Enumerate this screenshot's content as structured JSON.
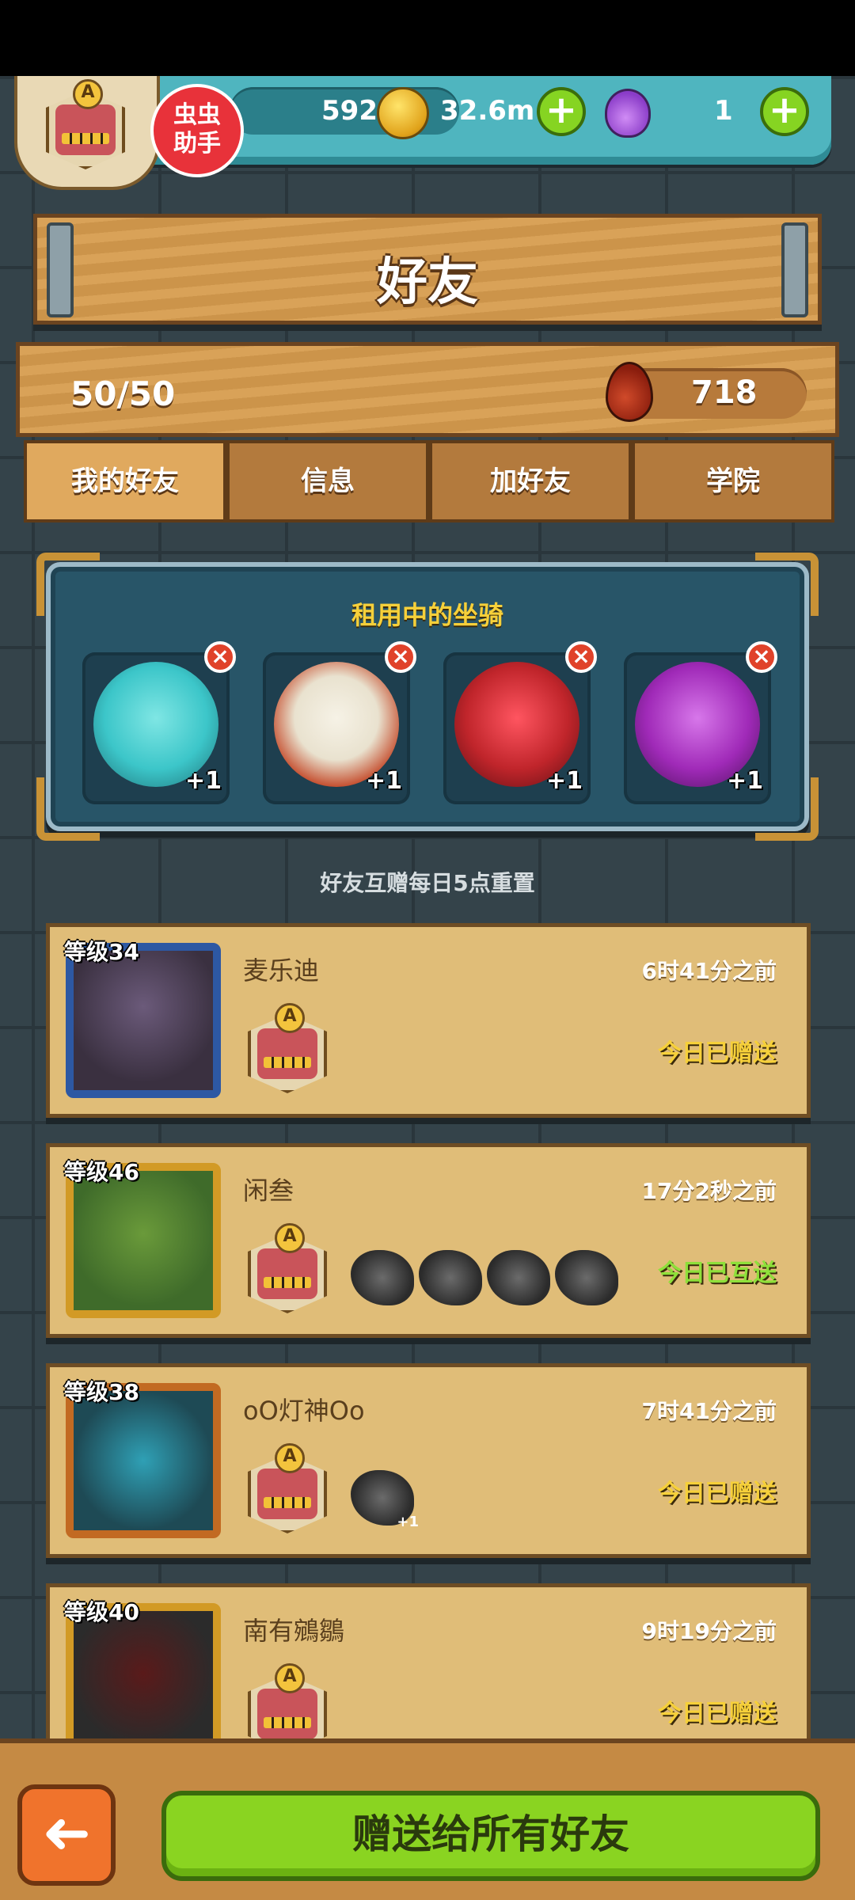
{
  "header": {
    "badge_text": "虫虫\n助手",
    "badge_line1": "虫虫",
    "badge_line2": "助手",
    "resource1": "592.5k",
    "gold": "32.6m",
    "potion": "1",
    "plus_label": "+",
    "shield_letter": "A"
  },
  "page": {
    "title": "好友",
    "friend_count": "50/50",
    "blood": "718"
  },
  "tabs": [
    {
      "label": "我的好友",
      "active": true
    },
    {
      "label": "信息",
      "active": false
    },
    {
      "label": "加好友",
      "active": false
    },
    {
      "label": "学院",
      "active": false
    }
  ],
  "mounts": {
    "title": "租用中的坐骑",
    "close_label": "×",
    "items": [
      {
        "bonus": "+1",
        "color": "#3cc6c9"
      },
      {
        "bonus": "+1",
        "color": "#e9e2cf"
      },
      {
        "bonus": "+1",
        "color": "#c0252b"
      },
      {
        "bonus": "+1",
        "color": "#a02ab8"
      }
    ]
  },
  "reset_note": "好友互赠每日5点重置",
  "friends": [
    {
      "level": "等级34",
      "name": "麦乐迪",
      "time": "6时41分之前",
      "status": "今日已赠送",
      "status_color": "#f6d03a",
      "frame_color": "#2d58a3",
      "portrait_color": "#3a3040",
      "pets": 0
    },
    {
      "level": "等级46",
      "name": "闲叁",
      "time": "17分2秒之前",
      "status": "今日已互送",
      "status_color": "#8ee03a",
      "frame_color": "#d29a25",
      "portrait_color": "#3f6b2a",
      "pets": 4
    },
    {
      "level": "等级38",
      "name": "oO灯神Oo",
      "time": "7时41分之前",
      "status": "今日已赠送",
      "status_color": "#f6d03a",
      "frame_color": "#c26a22",
      "portrait_color": "#1e4a55",
      "pets": 1,
      "pet_bonus": "+1"
    },
    {
      "level": "等级40",
      "name": "南有鵷鶵",
      "time": "9时19分之前",
      "status": "今日已赠送",
      "status_color": "#f6d03a",
      "frame_color": "#d29a25",
      "portrait_color": "#2b2b2b",
      "pets": 0
    }
  ],
  "footer": {
    "back_label": "➜",
    "gift_all_label": "赠送给所有好友"
  },
  "colors": {
    "accent_green": "#8ad421",
    "wood": "#d79c4e",
    "panel_blue": "#285568"
  }
}
